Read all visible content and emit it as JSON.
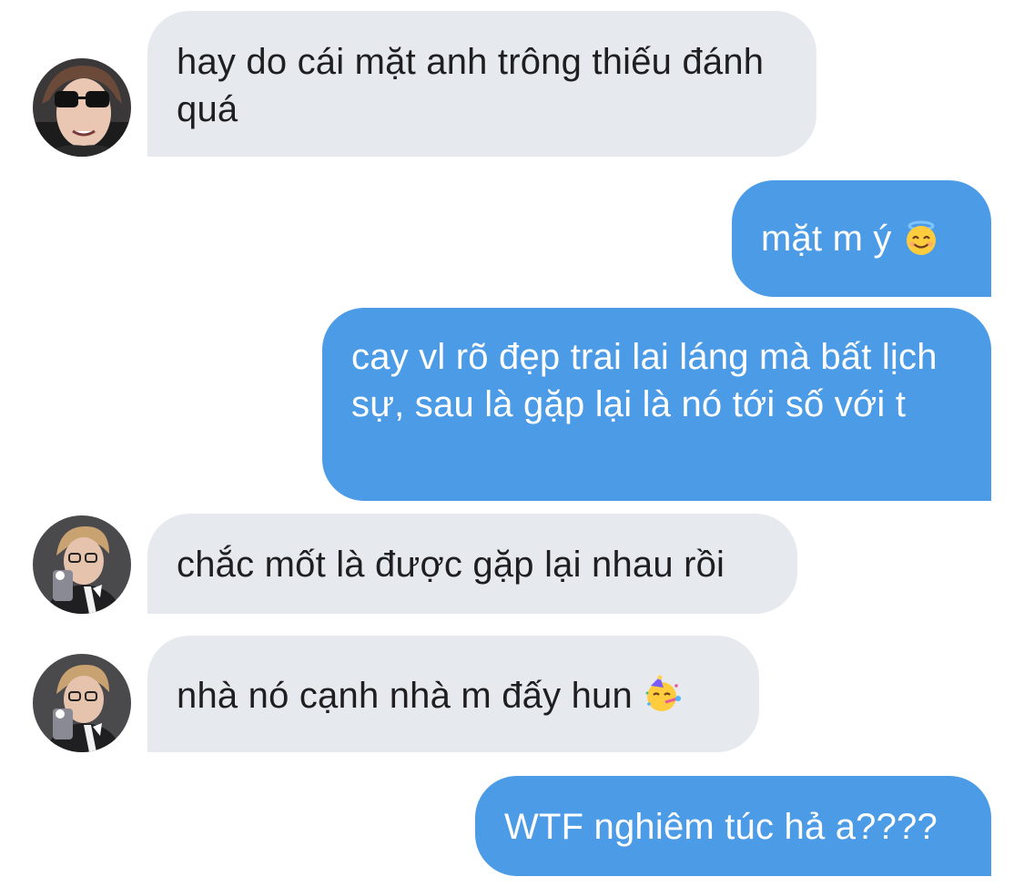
{
  "conversation": {
    "messages": [
      {
        "sender": "other",
        "text": "hay do cái mặt anh trông thiếu đánh quá"
      },
      {
        "sender": "me",
        "text": "mặt m ý",
        "emoji": "smiling-face-with-halo"
      },
      {
        "sender": "me",
        "text": "cay vl rõ đẹp trai lai láng mà bất lịch sự, sau là gặp lại là nó tới số với t"
      },
      {
        "sender": "other",
        "text": "chắc mốt là được gặp lại nhau rồi"
      },
      {
        "sender": "other",
        "text": "nhà nó cạnh nhà m đấy hun",
        "emoji": "partying-face"
      },
      {
        "sender": "me",
        "text": "WTF nghiêm túc hả a????"
      }
    ]
  },
  "colors": {
    "incoming_bubble": "#e6e9ee",
    "outgoing_bubble": "#4c9be6",
    "incoming_text": "#1f1f22",
    "outgoing_text": "#ffffff"
  }
}
